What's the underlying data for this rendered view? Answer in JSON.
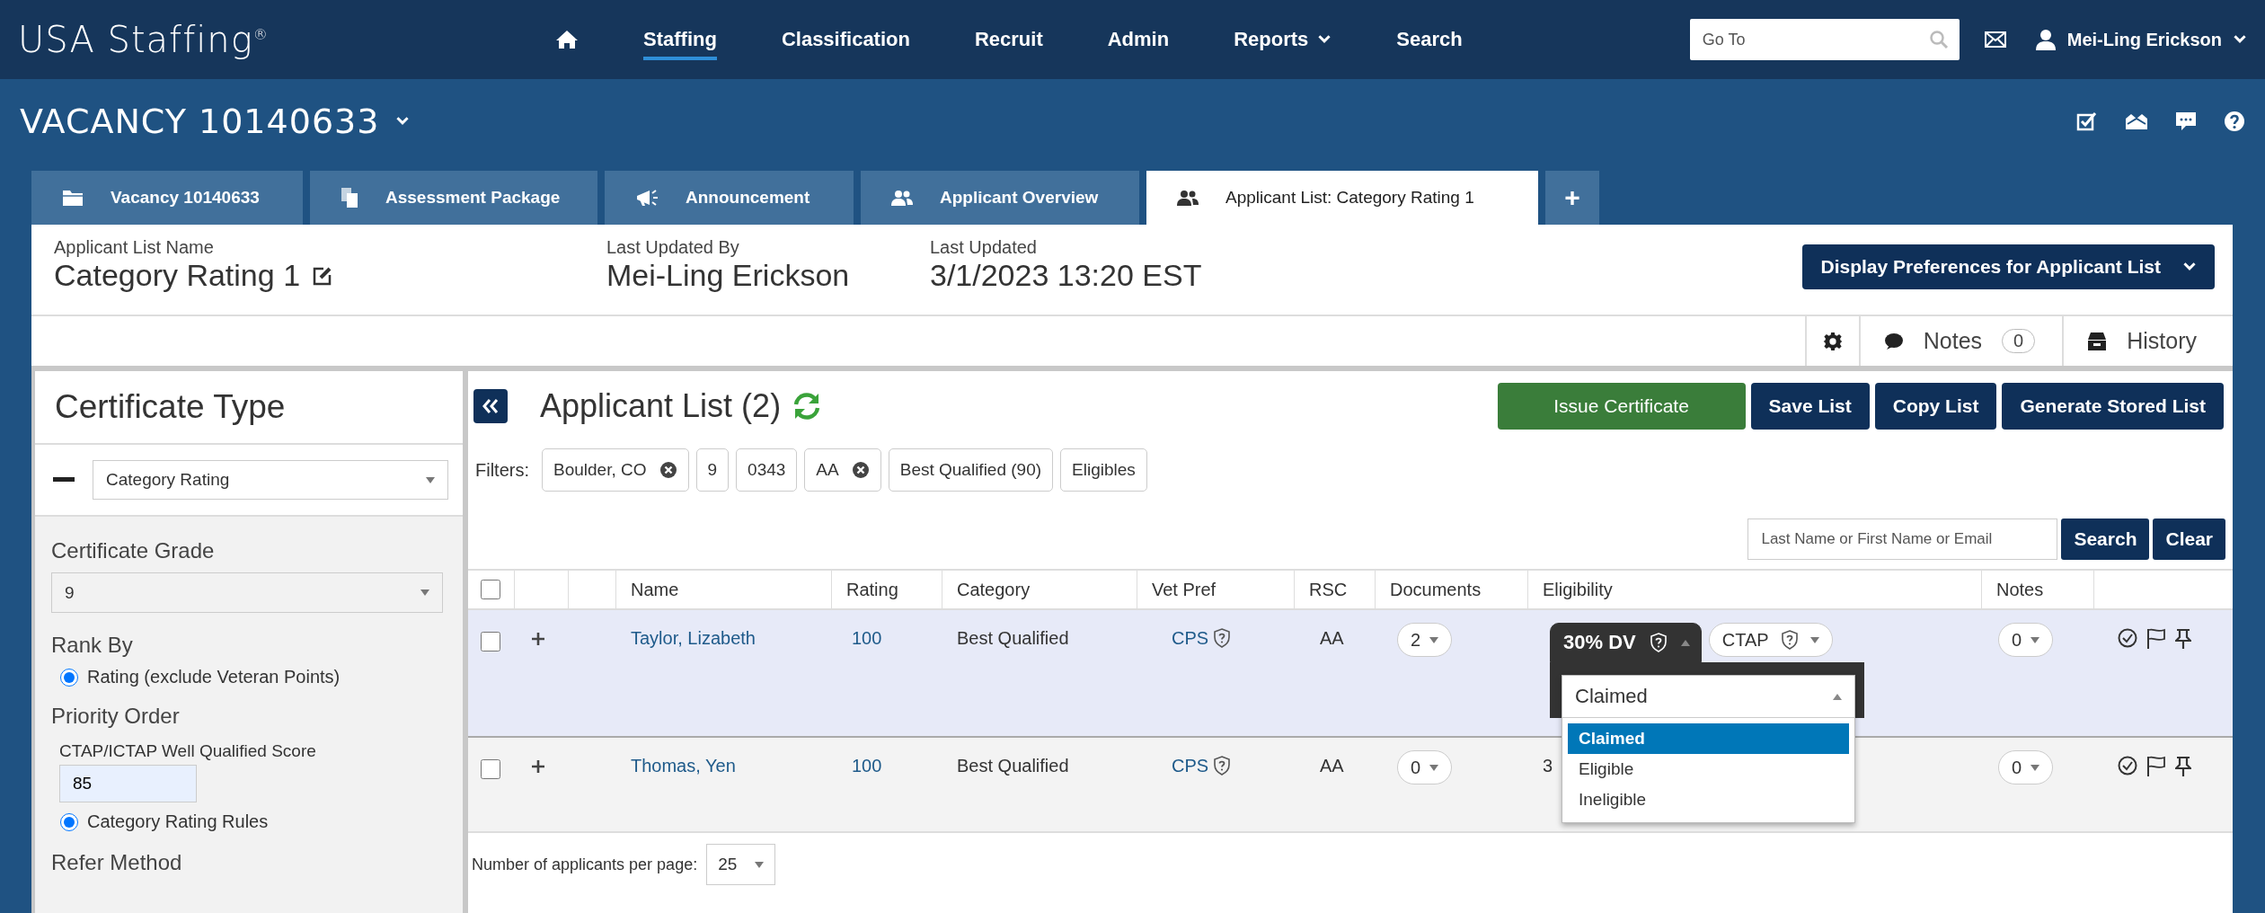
{
  "app": {
    "logo": "USA Staffing$^{®}$"
  },
  "nav": [
    {
      "label": "Staffing",
      "kind": "link",
      "selected": true
    },
    {
      "label": "Classification",
      "kind": "link",
      "selected": false
    },
    {
      "label": "Recruit",
      "kind": "link",
      "selected": false
    },
    {
      "label": "Admin",
      "kind": "link",
      "selected": false
    },
    {
      "label": "Reports",
      "kind": "menu",
      "selected": false
    },
    {
      "label": "Search",
      "kind": "link",
      "selected": false
    }
  ],
  "goto": {
    "placeholder": "Go To"
  },
  "user": {
    "name": "Mei-Ling Erickson"
  },
  "vacancy": {
    "title": "VACANCY 10140633"
  },
  "tabs": [
    {
      "label": "Vacancy 10140633",
      "selected": false
    },
    {
      "label": "Assessment Package",
      "selected": false
    },
    {
      "label": "Announcement",
      "selected": false
    },
    {
      "label": "Applicant Overview",
      "selected": false
    },
    {
      "label": "Applicant List: Category Rating 1",
      "selected": true
    }
  ],
  "add_tab": "+",
  "list_info": {
    "name_label": "Applicant List Name",
    "name": "Category Rating 1",
    "updated_by_label": "Last Updated By",
    "updated_by": "Mei-Ling Erickson",
    "updated_label": "Last Updated",
    "updated": "3/1/2023 13:20 EST",
    "display_button": "Display Preferences for Applicant List"
  },
  "toolbar": {
    "notes_label": "Notes",
    "notes_count": "0",
    "history_label": "History"
  },
  "certificate": {
    "title": "Certificate Type",
    "type": "Category Rating",
    "grade_label": "Certificate Grade",
    "grade": "9",
    "rank_label": "Rank By",
    "rank_options": [
      {
        "label": "Rating (exclude Veteran Points)",
        "selected": true
      }
    ],
    "priority_label": "Priority Order",
    "score_label": "CTAP/ICTAP Well Qualified Score",
    "score": "85",
    "priority_options": [
      {
        "label": "Category Rating Rules",
        "selected": true
      }
    ],
    "refer_label": "Refer Method"
  },
  "applicant_list": {
    "title": "Applicant List (2)",
    "buttons": [
      {
        "label": "Issue Certificate",
        "kind": "primary"
      },
      {
        "label": "Save List",
        "kind": "dark"
      },
      {
        "label": "Copy List",
        "kind": "dark"
      },
      {
        "label": "Generate Stored List",
        "kind": "dark"
      }
    ],
    "filters_label": "Filters:",
    "filters": [
      {
        "label": "Boulder, CO",
        "removable": true
      },
      {
        "label": "9",
        "removable": false
      },
      {
        "label": "0343",
        "removable": false
      },
      {
        "label": "AA",
        "removable": true
      },
      {
        "label": "Best Qualified (90)",
        "removable": false
      },
      {
        "label": "Eligibles",
        "removable": false
      }
    ],
    "search": {
      "placeholder": "Last Name or First Name or Email"
    },
    "search_button": "Search",
    "clear_button": "Clear",
    "select_all_checked": false,
    "columns": [
      "Name",
      "Rating",
      "Category",
      "Vet Pref",
      "RSC",
      "Documents",
      "Eligibility",
      "Notes"
    ],
    "rows": [
      {
        "checked": false,
        "selected": true,
        "name": "Taylor, Lizabeth",
        "rating": "100",
        "category": "Best Qualified",
        "vet_pref": "CPS",
        "rsc": "AA",
        "documents": "2",
        "eligibility": [
          {
            "label": "30% DV",
            "open": true
          },
          {
            "label": "CTAP",
            "open": false
          }
        ],
        "notes": "0"
      },
      {
        "checked": false,
        "selected": false,
        "name": "Thomas, Yen",
        "rating": "100",
        "category": "Best Qualified",
        "vet_pref": "CPS",
        "rsc": "AA",
        "documents": "0",
        "eligibility_text": "3",
        "notes": "0"
      }
    ],
    "eligibility_menu": {
      "value": "Claimed",
      "options": [
        {
          "label": "Claimed",
          "selected": true
        },
        {
          "label": "Eligible",
          "selected": false
        },
        {
          "label": "Ineligible",
          "selected": false
        }
      ]
    },
    "per_page_label": "Number of applicants per page:",
    "per_page": "25"
  }
}
